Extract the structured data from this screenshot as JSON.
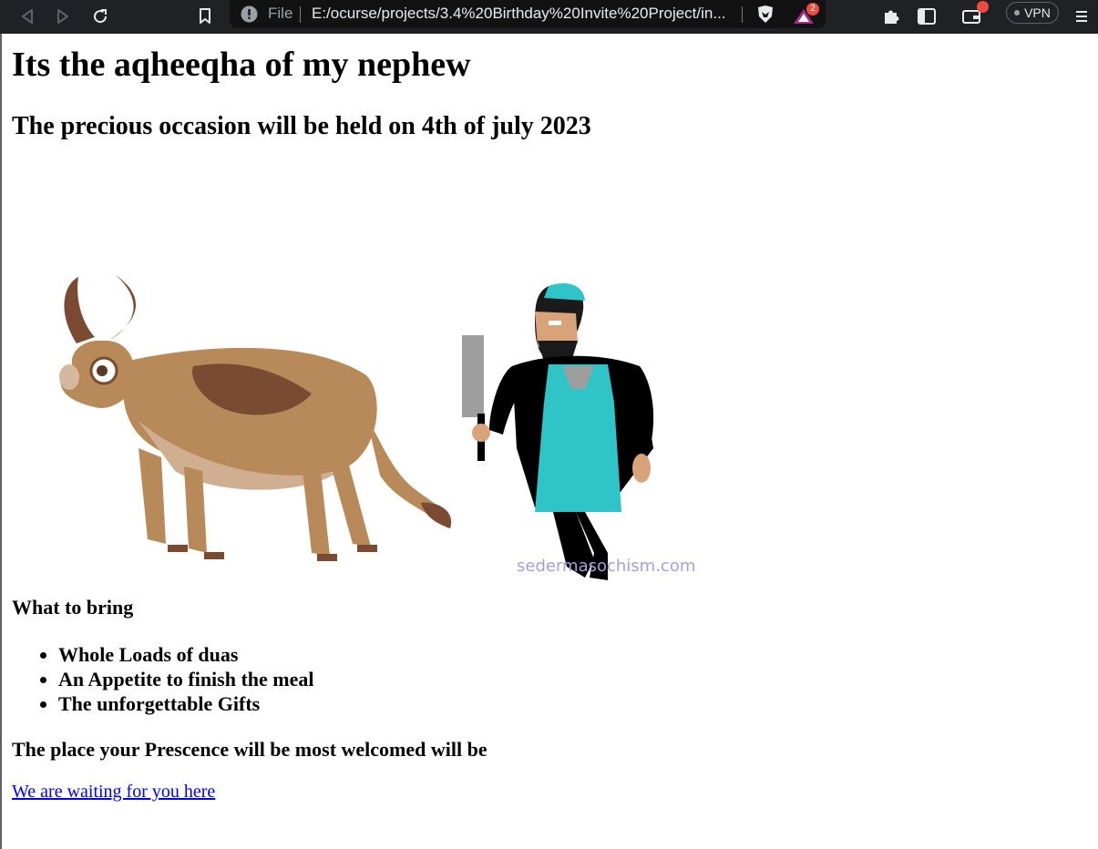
{
  "browser": {
    "file_label": "File",
    "url": "E:/ocurse/projects/3.4%20Birthday%20Invite%20Project/in...",
    "notification_count": "2",
    "vpn_label": "VPN"
  },
  "page": {
    "title": "Its the aqheeqha of my nephew",
    "subtitle": "The precious occasion will be held on 4th of july 2023",
    "image_watermark": "sedermasochism.com",
    "bring_heading": "What to bring",
    "bring_items": [
      "Whole Loads of duas",
      "An Appetite to finish the meal",
      "The unforgettable Gifts"
    ],
    "place_heading": "The place your Prescence will be most welcomed will be",
    "link_text": "We are waiting for you here"
  }
}
